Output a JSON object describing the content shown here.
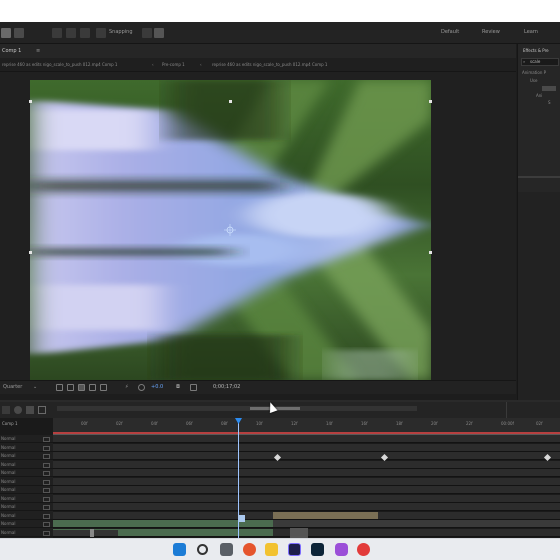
{
  "toolbar": {
    "workspace_toggle": "Snapping",
    "workspaces": [
      "Default",
      "Review",
      "Learn"
    ]
  },
  "panels": {
    "comp_panel_tab": "Comp 1",
    "effects_panel_title": "Effects & Pre",
    "effects_search_value": "scale",
    "effects_tree": [
      "Animation P",
      "Use",
      "Ani",
      "S"
    ]
  },
  "comp_tabs": [
    "reprise 460 as edits nigo_scale_to_push 012.mp4 Comp 1",
    "Pre-comp 1",
    "reprise 460 as edits nigo_scale_to_push 012.mp4 Comp 1"
  ],
  "viewer_controls": {
    "magnification": "Quarter",
    "timecode": "0;00;17;02",
    "zoom_hint": "+0.0"
  },
  "timeline": {
    "left_header": "Comp 1",
    "ruler_ticks": [
      "00f",
      "02f",
      "04f",
      "06f",
      "08f",
      "10f",
      "12f",
      "14f",
      "16f",
      "18f",
      "20f",
      "22f",
      "00:00f",
      "02f",
      "04f",
      "06f"
    ],
    "layer_modes": [
      "Normal",
      "Normal",
      "Normal",
      "Normal",
      "Normal",
      "Normal",
      "Normal",
      "Normal",
      "Normal",
      "Normal",
      "Normal",
      "Normal"
    ],
    "playhead_label": "0;00;17;02"
  },
  "colors": {
    "accent_blue": "#2d8cf0",
    "keyframe_red": "#c83c3c",
    "layer_green": "#4b6b4f",
    "layer_tan": "#7a6f55"
  },
  "taskbar": {
    "icons": [
      "windows-start-icon",
      "search-icon",
      "task-view-icon",
      "browser-icon",
      "file-explorer-icon",
      "after-effects-icon",
      "photoshop-icon",
      "media-encoder-icon",
      "chrome-icon"
    ]
  }
}
